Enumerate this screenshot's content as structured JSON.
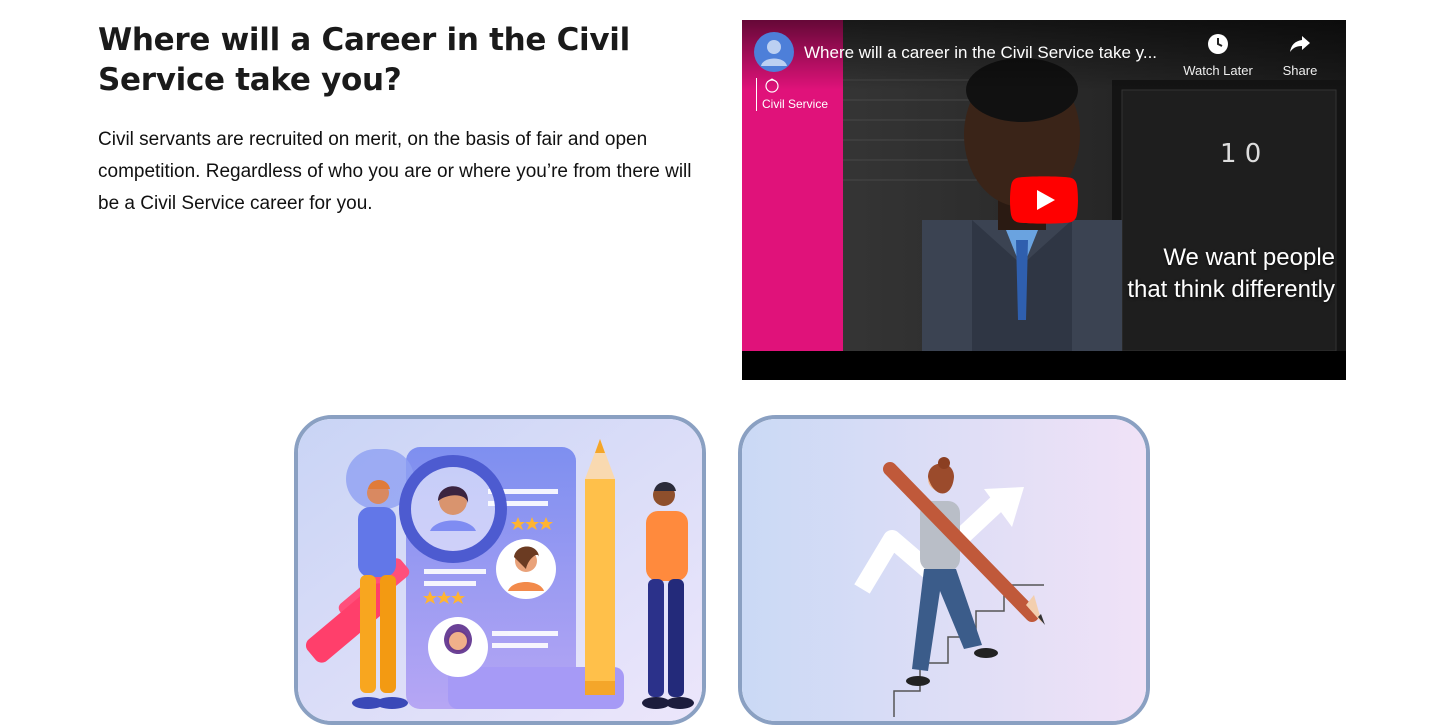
{
  "intro": {
    "heading": "Where will a Career in the Civil Service take you?",
    "body": "Civil servants are recruited on merit, on the basis of fair and open competition. Regardless of who you are or where you’re from there will be a Civil Service career for you."
  },
  "video": {
    "title": "Where will a career in the Civil Service take y...",
    "watch_later_label": "Watch Later",
    "share_label": "Share",
    "brand_label": "Civil Service",
    "caption_line1": "We want people",
    "caption_line2": "that think differently",
    "icons": {
      "avatar": "channel-avatar",
      "clock": "watch-later-icon",
      "share": "share-arrow-icon",
      "play": "youtube-play-icon"
    }
  },
  "cards": [
    {
      "name": "recruitment-illustration-card",
      "icon": "magnifier-profiles-illustration"
    },
    {
      "name": "career-growth-illustration-card",
      "icon": "staircase-pencil-illustration"
    }
  ],
  "colors": {
    "brand_pink": "#e0127a",
    "card_border": "#8aa0c2",
    "youtube_red": "#ff0000"
  }
}
